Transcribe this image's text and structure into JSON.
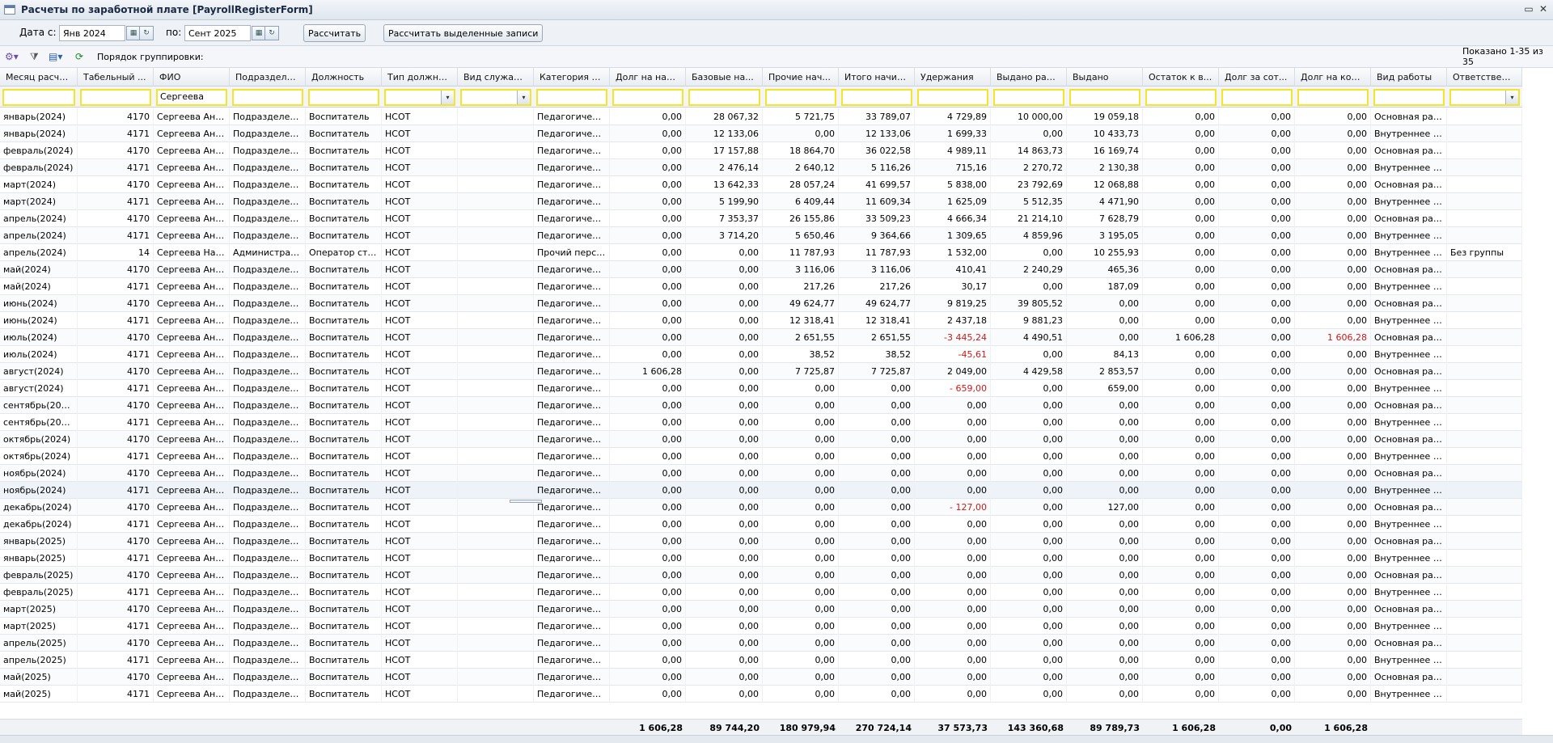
{
  "window": {
    "title": "Расчеты по заработной плате [PayrollRegisterForm]"
  },
  "filters": {
    "date_from_label": "Дата с:",
    "date_from": "Янв 2024",
    "date_to_label": "по:",
    "date_to": "Сент 2025",
    "calc_button": "Рассчитать",
    "calc_selected_button": "Рассчитать выделенные записи"
  },
  "toolbar": {
    "grouping_label": "Порядок группировки:",
    "shown_label": "Показано 1-35 из 35"
  },
  "columns": [
    "Месяц расчета",
    "Табельный ...",
    "ФИО",
    "Подразделение",
    "Должность",
    "Тип должности",
    "Вид служащего",
    "Категория п...",
    "Долг на нач...",
    "Базовые на...",
    "Прочие нач...",
    "Итого начис...",
    "Удержания",
    "Выдано ран...",
    "Выдано",
    "Остаток к в...",
    "Долг за сот...",
    "Долг на кон...",
    "Вид работы",
    "Ответственны..."
  ],
  "filter_row": {
    "fio": "Сергеева"
  },
  "rows": [
    [
      "январь(2024)",
      "4170",
      "Сергеева Анж...",
      "Подразделени...",
      "Воспитатель",
      "НСОТ",
      "",
      "Педагогически...",
      "0,00",
      "28 067,32",
      "5 721,75",
      "33 789,07",
      "4 729,89",
      "10 000,00",
      "19 059,18",
      "0,00",
      "0,00",
      "0,00",
      "Основная раб...",
      ""
    ],
    [
      "январь(2024)",
      "4171",
      "Сергеева Анж...",
      "Подразделени...",
      "Воспитатель",
      "НСОТ",
      "",
      "Педагогически...",
      "0,00",
      "12 133,06",
      "0,00",
      "12 133,06",
      "1 699,33",
      "0,00",
      "10 433,73",
      "0,00",
      "0,00",
      "0,00",
      "Внутреннее со...",
      ""
    ],
    [
      "февраль(2024)",
      "4170",
      "Сергеева Анж...",
      "Подразделени...",
      "Воспитатель",
      "НСОТ",
      "",
      "Педагогически...",
      "0,00",
      "17 157,88",
      "18 864,70",
      "36 022,58",
      "4 989,11",
      "14 863,73",
      "16 169,74",
      "0,00",
      "0,00",
      "0,00",
      "Основная раб...",
      ""
    ],
    [
      "февраль(2024)",
      "4171",
      "Сергеева Анж...",
      "Подразделени...",
      "Воспитатель",
      "НСОТ",
      "",
      "Педагогически...",
      "0,00",
      "2 476,14",
      "2 640,12",
      "5 116,26",
      "715,16",
      "2 270,72",
      "2 130,38",
      "0,00",
      "0,00",
      "0,00",
      "Внутреннее со...",
      ""
    ],
    [
      "март(2024)",
      "4170",
      "Сергеева Анж...",
      "Подразделени...",
      "Воспитатель",
      "НСОТ",
      "",
      "Педагогически...",
      "0,00",
      "13 642,33",
      "28 057,24",
      "41 699,57",
      "5 838,00",
      "23 792,69",
      "12 068,88",
      "0,00",
      "0,00",
      "0,00",
      "Основная раб...",
      ""
    ],
    [
      "март(2024)",
      "4171",
      "Сергеева Анж...",
      "Подразделени...",
      "Воспитатель",
      "НСОТ",
      "",
      "Педагогически...",
      "0,00",
      "5 199,90",
      "6 409,44",
      "11 609,34",
      "1 625,09",
      "5 512,35",
      "4 471,90",
      "0,00",
      "0,00",
      "0,00",
      "Внутреннее со...",
      ""
    ],
    [
      "апрель(2024)",
      "4170",
      "Сергеева Анж...",
      "Подразделени...",
      "Воспитатель",
      "НСОТ",
      "",
      "Педагогически...",
      "0,00",
      "7 353,37",
      "26 155,86",
      "33 509,23",
      "4 666,34",
      "21 214,10",
      "7 628,79",
      "0,00",
      "0,00",
      "0,00",
      "Основная раб...",
      ""
    ],
    [
      "апрель(2024)",
      "4171",
      "Сергеева Анж...",
      "Подразделени...",
      "Воспитатель",
      "НСОТ",
      "",
      "Педагогически...",
      "0,00",
      "3 714,20",
      "5 650,46",
      "9 364,66",
      "1 309,65",
      "4 859,96",
      "3 195,05",
      "0,00",
      "0,00",
      "0,00",
      "Внутреннее со...",
      ""
    ],
    [
      "апрель(2024)",
      "14",
      "Сергеева Ната...",
      "Администрати...",
      "Оператор стир...",
      "НСОТ",
      "",
      "Прочий персо...",
      "0,00",
      "0,00",
      "11 787,93",
      "11 787,93",
      "1 532,00",
      "0,00",
      "10 255,93",
      "0,00",
      "0,00",
      "0,00",
      "Внутреннее со...",
      "Без группы"
    ],
    [
      "май(2024)",
      "4170",
      "Сергеева Анж...",
      "Подразделени...",
      "Воспитатель",
      "НСОТ",
      "",
      "Педагогически...",
      "0,00",
      "0,00",
      "3 116,06",
      "3 116,06",
      "410,41",
      "2 240,29",
      "465,36",
      "0,00",
      "0,00",
      "0,00",
      "Основная раб...",
      ""
    ],
    [
      "май(2024)",
      "4171",
      "Сергеева Анж...",
      "Подразделени...",
      "Воспитатель",
      "НСОТ",
      "",
      "Педагогически...",
      "0,00",
      "0,00",
      "217,26",
      "217,26",
      "30,17",
      "0,00",
      "187,09",
      "0,00",
      "0,00",
      "0,00",
      "Внутреннее со...",
      ""
    ],
    [
      "июнь(2024)",
      "4170",
      "Сергеева Анж...",
      "Подразделени...",
      "Воспитатель",
      "НСОТ",
      "",
      "Педагогически...",
      "0,00",
      "0,00",
      "49 624,77",
      "49 624,77",
      "9 819,25",
      "39 805,52",
      "0,00",
      "0,00",
      "0,00",
      "0,00",
      "Основная раб...",
      ""
    ],
    [
      "июнь(2024)",
      "4171",
      "Сергеева Анж...",
      "Подразделени...",
      "Воспитатель",
      "НСОТ",
      "",
      "Педагогически...",
      "0,00",
      "0,00",
      "12 318,41",
      "12 318,41",
      "2 437,18",
      "9 881,23",
      "0,00",
      "0,00",
      "0,00",
      "0,00",
      "Внутреннее со...",
      ""
    ],
    [
      "июль(2024)",
      "4170",
      "Сергеева Анж...",
      "Подразделени...",
      "Воспитатель",
      "НСОТ",
      "",
      "Педагогически...",
      "0,00",
      "0,00",
      "2 651,55",
      "2 651,55",
      "-3 445,24",
      "4 490,51",
      "0,00",
      "1 606,28",
      "0,00",
      "1 606,28",
      "Основная раб...",
      ""
    ],
    [
      "июль(2024)",
      "4171",
      "Сергеева Анж...",
      "Подразделени...",
      "Воспитатель",
      "НСОТ",
      "",
      "Педагогически...",
      "0,00",
      "0,00",
      "38,52",
      "38,52",
      "-45,61",
      "0,00",
      "84,13",
      "0,00",
      "0,00",
      "0,00",
      "Внутреннее со...",
      ""
    ],
    [
      "август(2024)",
      "4170",
      "Сергеева Анж...",
      "Подразделени...",
      "Воспитатель",
      "НСОТ",
      "",
      "Педагогически...",
      "1 606,28",
      "0,00",
      "7 725,87",
      "7 725,87",
      "2 049,00",
      "4 429,58",
      "2 853,57",
      "0,00",
      "0,00",
      "0,00",
      "Основная раб...",
      ""
    ],
    [
      "август(2024)",
      "4171",
      "Сергеева Анж...",
      "Подразделени...",
      "Воспитатель",
      "НСОТ",
      "",
      "Педагогически...",
      "0,00",
      "0,00",
      "0,00",
      "0,00",
      "- 659,00",
      "0,00",
      "659,00",
      "0,00",
      "0,00",
      "0,00",
      "Внутреннее со...",
      ""
    ],
    [
      "сентябрь(2024)",
      "4170",
      "Сергеева Анж...",
      "Подразделени...",
      "Воспитатель",
      "НСОТ",
      "",
      "Педагогически...",
      "0,00",
      "0,00",
      "0,00",
      "0,00",
      "0,00",
      "0,00",
      "0,00",
      "0,00",
      "0,00",
      "0,00",
      "Основная раб...",
      ""
    ],
    [
      "сентябрь(2024)",
      "4171",
      "Сергеева Анж...",
      "Подразделени...",
      "Воспитатель",
      "НСОТ",
      "",
      "Педагогически...",
      "0,00",
      "0,00",
      "0,00",
      "0,00",
      "0,00",
      "0,00",
      "0,00",
      "0,00",
      "0,00",
      "0,00",
      "Внутреннее со...",
      ""
    ],
    [
      "октябрь(2024)",
      "4170",
      "Сергеева Анж...",
      "Подразделени...",
      "Воспитатель",
      "НСОТ",
      "",
      "Педагогически...",
      "0,00",
      "0,00",
      "0,00",
      "0,00",
      "0,00",
      "0,00",
      "0,00",
      "0,00",
      "0,00",
      "0,00",
      "Основная раб...",
      ""
    ],
    [
      "октябрь(2024)",
      "4171",
      "Сергеева Анж...",
      "Подразделени...",
      "Воспитатель",
      "НСОТ",
      "",
      "Педагогически...",
      "0,00",
      "0,00",
      "0,00",
      "0,00",
      "0,00",
      "0,00",
      "0,00",
      "0,00",
      "0,00",
      "0,00",
      "Внутреннее со...",
      ""
    ],
    [
      "ноябрь(2024)",
      "4170",
      "Сергеева Анж...",
      "Подразделени...",
      "Воспитатель",
      "НСОТ",
      "",
      "Педагогически...",
      "0,00",
      "0,00",
      "0,00",
      "0,00",
      "0,00",
      "0,00",
      "0,00",
      "0,00",
      "0,00",
      "0,00",
      "Основная раб...",
      ""
    ],
    [
      "ноябрь(2024)",
      "4171",
      "Сергеева Анж...",
      "Подразделени...",
      "Воспитатель",
      "НСОТ",
      "",
      "Педагогически...",
      "0,00",
      "0,00",
      "0,00",
      "0,00",
      "0,00",
      "0,00",
      "0,00",
      "0,00",
      "0,00",
      "0,00",
      "Внутреннее со...",
      ""
    ],
    [
      "декабрь(2024)",
      "4170",
      "Сергеева Анж...",
      "Подразделени...",
      "Воспитатель",
      "НСОТ",
      "",
      "Педагогически...",
      "0,00",
      "0,00",
      "0,00",
      "0,00",
      "- 127,00",
      "0,00",
      "127,00",
      "0,00",
      "0,00",
      "0,00",
      "Основная раб...",
      ""
    ],
    [
      "декабрь(2024)",
      "4171",
      "Сергеева Анж...",
      "Подразделени...",
      "Воспитатель",
      "НСОТ",
      "",
      "Педагогически...",
      "0,00",
      "0,00",
      "0,00",
      "0,00",
      "0,00",
      "0,00",
      "0,00",
      "0,00",
      "0,00",
      "0,00",
      "Внутреннее со...",
      ""
    ],
    [
      "январь(2025)",
      "4170",
      "Сергеева Анж...",
      "Подразделени...",
      "Воспитатель",
      "НСОТ",
      "",
      "Педагогически...",
      "0,00",
      "0,00",
      "0,00",
      "0,00",
      "0,00",
      "0,00",
      "0,00",
      "0,00",
      "0,00",
      "0,00",
      "Основная раб...",
      ""
    ],
    [
      "январь(2025)",
      "4171",
      "Сергеева Анж...",
      "Подразделени...",
      "Воспитатель",
      "НСОТ",
      "",
      "Педагогически...",
      "0,00",
      "0,00",
      "0,00",
      "0,00",
      "0,00",
      "0,00",
      "0,00",
      "0,00",
      "0,00",
      "0,00",
      "Внутреннее со...",
      ""
    ],
    [
      "февраль(2025)",
      "4170",
      "Сергеева Анж...",
      "Подразделени...",
      "Воспитатель",
      "НСОТ",
      "",
      "Педагогически...",
      "0,00",
      "0,00",
      "0,00",
      "0,00",
      "0,00",
      "0,00",
      "0,00",
      "0,00",
      "0,00",
      "0,00",
      "Основная раб...",
      ""
    ],
    [
      "февраль(2025)",
      "4171",
      "Сергеева Анж...",
      "Подразделени...",
      "Воспитатель",
      "НСОТ",
      "",
      "Педагогически...",
      "0,00",
      "0,00",
      "0,00",
      "0,00",
      "0,00",
      "0,00",
      "0,00",
      "0,00",
      "0,00",
      "0,00",
      "Внутреннее со...",
      ""
    ],
    [
      "март(2025)",
      "4170",
      "Сергеева Анж...",
      "Подразделени...",
      "Воспитатель",
      "НСОТ",
      "",
      "Педагогически...",
      "0,00",
      "0,00",
      "0,00",
      "0,00",
      "0,00",
      "0,00",
      "0,00",
      "0,00",
      "0,00",
      "0,00",
      "Основная раб...",
      ""
    ],
    [
      "март(2025)",
      "4171",
      "Сергеева Анж...",
      "Подразделени...",
      "Воспитатель",
      "НСОТ",
      "",
      "Педагогически...",
      "0,00",
      "0,00",
      "0,00",
      "0,00",
      "0,00",
      "0,00",
      "0,00",
      "0,00",
      "0,00",
      "0,00",
      "Внутреннее со...",
      ""
    ],
    [
      "апрель(2025)",
      "4170",
      "Сергеева Анж...",
      "Подразделени...",
      "Воспитатель",
      "НСОТ",
      "",
      "Педагогически...",
      "0,00",
      "0,00",
      "0,00",
      "0,00",
      "0,00",
      "0,00",
      "0,00",
      "0,00",
      "0,00",
      "0,00",
      "Основная раб...",
      ""
    ],
    [
      "апрель(2025)",
      "4171",
      "Сергеева Анж...",
      "Подразделени...",
      "Воспитатель",
      "НСОТ",
      "",
      "Педагогически...",
      "0,00",
      "0,00",
      "0,00",
      "0,00",
      "0,00",
      "0,00",
      "0,00",
      "0,00",
      "0,00",
      "0,00",
      "Внутреннее со...",
      ""
    ],
    [
      "май(2025)",
      "4170",
      "Сергеева Анж...",
      "Подразделени...",
      "Воспитатель",
      "НСОТ",
      "",
      "Педагогически...",
      "0,00",
      "0,00",
      "0,00",
      "0,00",
      "0,00",
      "0,00",
      "0,00",
      "0,00",
      "0,00",
      "0,00",
      "Основная раб...",
      ""
    ],
    [
      "май(2025)",
      "4171",
      "Сергеева Анж...",
      "Подразделени...",
      "Воспитатель",
      "НСОТ",
      "",
      "Педагогически...",
      "0,00",
      "0,00",
      "0,00",
      "0,00",
      "0,00",
      "0,00",
      "0,00",
      "0,00",
      "0,00",
      "0,00",
      "Внутреннее со...",
      ""
    ]
  ],
  "totals": [
    "1 606,28",
    "89 744,20",
    "180 979,94",
    "270 724,14",
    "37 573,73",
    "143 360,68",
    "89 789,73",
    "1 606,28",
    "0,00",
    "1 606,28"
  ],
  "colors": {
    "negative": "#d01818",
    "filter_border": "#f2e52a",
    "selected_row": "#eef3fa"
  }
}
